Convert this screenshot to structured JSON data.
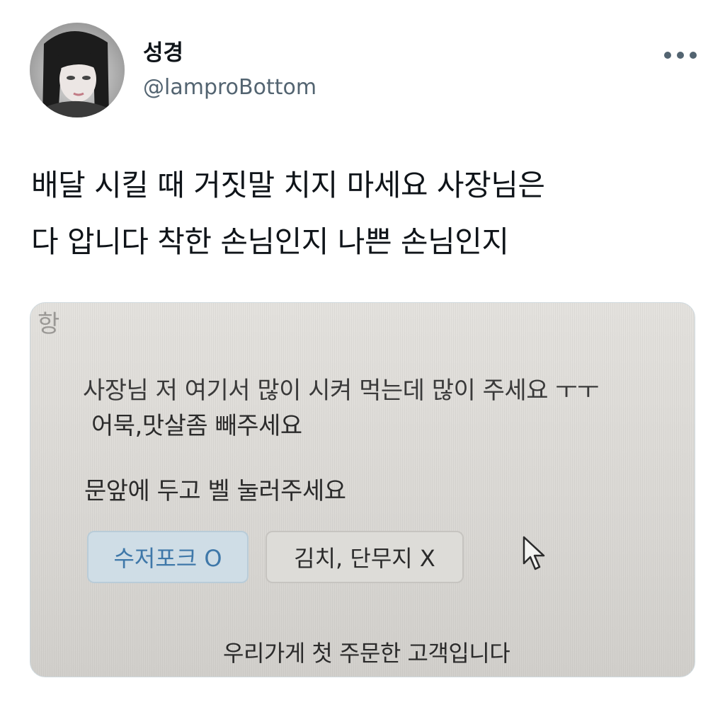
{
  "tweet": {
    "author": {
      "display_name": "성경",
      "handle": "@lamproBottom",
      "avatar": "avatar-photo"
    },
    "more_icon": "more-horizontal-icon",
    "text_lines": [
      "배달 시킬 때 거짓말 치지 마세요 사장님은",
      "다 압니다 착한 손님인지 나쁜 손님인지"
    ]
  },
  "photo": {
    "corner_text": "항",
    "request_line_1": "사장님 저 여기서 많이 시켜 먹는데 많이 주세요 ㅜㅜ",
    "request_line_2": "어묵,맛살좀 빼주세요",
    "delivery_note": "문앞에 두고 벨 눌러주세요",
    "chip_spoon_fork": "수저포크 O",
    "chip_kimchi": "김치, 단무지 X",
    "cursor_icon": "mouse-cursor-icon",
    "customer_note": "우리가게 첫 주문한 고객입니다"
  },
  "colors": {
    "text_primary": "#0f1419",
    "text_secondary": "#536471",
    "chip_blue_text": "#3f78a9",
    "chip_blue_bg": "#cfdde6"
  }
}
